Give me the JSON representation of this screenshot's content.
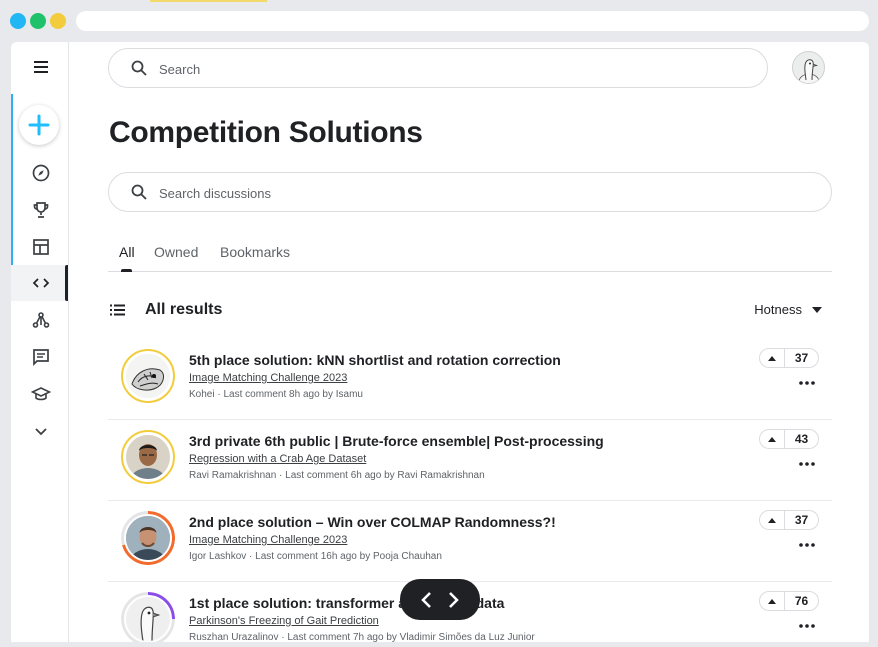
{
  "header": {
    "search_placeholder": "Search"
  },
  "page": {
    "title": "Competition Solutions",
    "discussion_search_placeholder": "Search discussions"
  },
  "tabs": [
    {
      "label": "All",
      "active": true
    },
    {
      "label": "Owned",
      "active": false
    },
    {
      "label": "Bookmarks",
      "active": false
    }
  ],
  "results": {
    "heading": "All results",
    "sort_label": "Hotness"
  },
  "sidebar": {
    "icons": [
      "menu-icon",
      "create-icon",
      "compass-icon",
      "trophy-icon",
      "table-icon",
      "code-icon",
      "models-icon",
      "discussion-icon",
      "learn-icon",
      "expand-icon"
    ],
    "active": "code-icon"
  },
  "topics": [
    {
      "title": "5th place solution: kNN shortlist and rotation correction",
      "competition": "Image Matching Challenge 2023",
      "meta": "Kohei · Last comment 8h ago by Isamu",
      "votes": "37",
      "ring_color": "#f2cc3d"
    },
    {
      "title": "3rd private 6th public | Brute-force ensemble| Post-processing",
      "competition": "Regression with a Crab Age Dataset",
      "meta": "Ravi Ramakrishnan · Last comment 6h ago by Ravi Ramakrishnan",
      "votes": "43",
      "ring_color": "#f2cc3d"
    },
    {
      "title": "2nd place solution – Win over COLMAP Randomness?!",
      "competition": "Image Matching Challenge 2023",
      "meta": "Igor Lashkov · Last comment 16h ago by Pooja Chauhan",
      "votes": "37",
      "ring_color": "#f26b2c"
    },
    {
      "title": "1st place solution: transformer a",
      "title_tail": "tion data",
      "competition": "Parkinson's Freezing of Gait Prediction",
      "meta": "Ruszhan Urazalinov · Last comment 7h ago by Vladimir Simões da Luz Junior",
      "votes": "76",
      "ring_color": "#8b4dea"
    }
  ],
  "pager": {
    "prev_icon": "chevron-left-icon",
    "next_icon": "chevron-right-icon"
  }
}
